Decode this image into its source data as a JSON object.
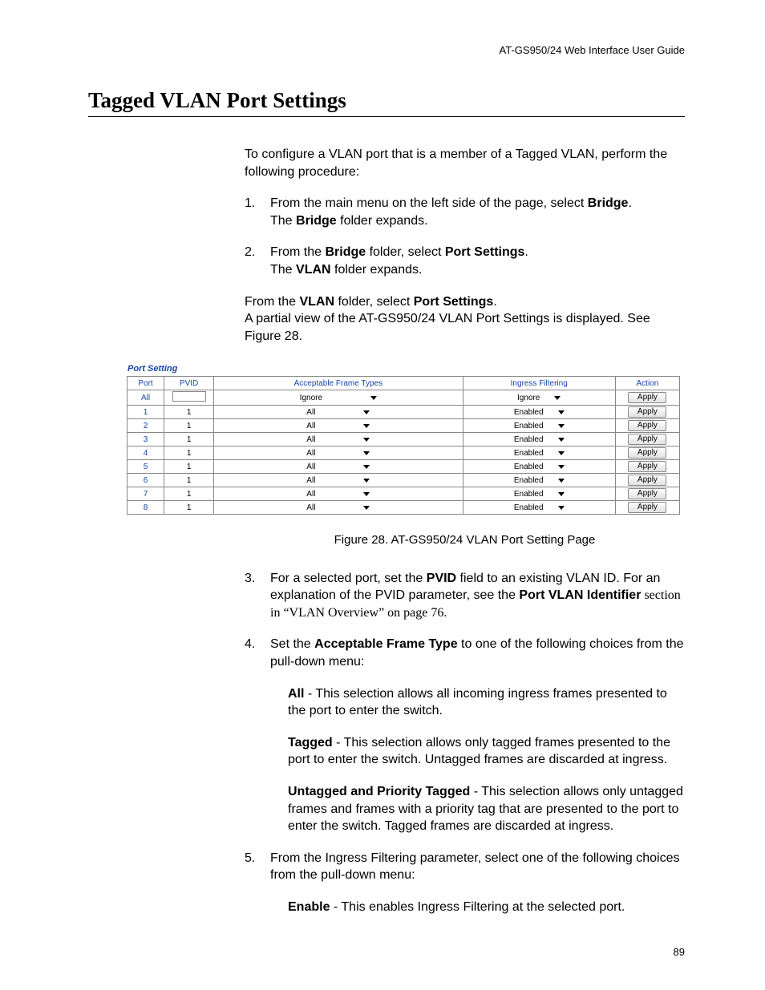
{
  "header": {
    "guide": "AT-GS950/24  Web Interface User Guide"
  },
  "title": "Tagged VLAN Port Settings",
  "intro": "To configure a VLAN port that is a member of a Tagged VLAN, perform the following procedure:",
  "step1": {
    "num": "1.",
    "a": "From the main menu on the left side of the page, select ",
    "b": "Bridge",
    "c": ".",
    "d": "The ",
    "e": "Bridge",
    "f": " folder expands."
  },
  "step2": {
    "num": "2.",
    "a": "From the ",
    "b": "Bridge",
    "c": " folder, select ",
    "d": "Port Settings",
    "e": ".",
    "f": "The ",
    "g": "VLAN",
    "h": " folder expands."
  },
  "vlan": {
    "a": "From the ",
    "b": "VLAN",
    "c": " folder, select ",
    "d": "Port Settings",
    "e": ".",
    "f": "A partial view of the AT-GS950/24 VLAN Port Settings is displayed. See Figure 28."
  },
  "ui": {
    "heading": "Port Setting",
    "cols": {
      "port": "Port",
      "pvid": "PVID",
      "aft": "Acceptable Frame Types",
      "if": "Ingress Filtering",
      "act": "Action"
    },
    "allrow": {
      "port": "All",
      "aft": "Ignore",
      "if": "Ignore",
      "btn": "Apply"
    },
    "rows": [
      {
        "port": "1",
        "pvid": "1",
        "aft": "All",
        "if": "Enabled",
        "btn": "Apply"
      },
      {
        "port": "2",
        "pvid": "1",
        "aft": "All",
        "if": "Enabled",
        "btn": "Apply"
      },
      {
        "port": "3",
        "pvid": "1",
        "aft": "All",
        "if": "Enabled",
        "btn": "Apply"
      },
      {
        "port": "4",
        "pvid": "1",
        "aft": "All",
        "if": "Enabled",
        "btn": "Apply"
      },
      {
        "port": "5",
        "pvid": "1",
        "aft": "All",
        "if": "Enabled",
        "btn": "Apply"
      },
      {
        "port": "6",
        "pvid": "1",
        "aft": "All",
        "if": "Enabled",
        "btn": "Apply"
      },
      {
        "port": "7",
        "pvid": "1",
        "aft": "All",
        "if": "Enabled",
        "btn": "Apply"
      },
      {
        "port": "8",
        "pvid": "1",
        "aft": "All",
        "if": "Enabled",
        "btn": "Apply"
      }
    ]
  },
  "figcap": "Figure 28. AT-GS950/24 VLAN Port Setting Page",
  "step3": {
    "num": "3.",
    "a": "For a selected port, set the ",
    "b": "PVID",
    "c": " field to an existing VLAN ID. For an explanation of the PVID parameter, see the ",
    "d": "Port VLAN Identifier",
    "e": " section in “VLAN Overview” on page 76."
  },
  "step4": {
    "num": "4.",
    "a": "Set the ",
    "b": "Acceptable Frame Type",
    "c": " to one of the following choices from the pull-down menu:"
  },
  "opt_all": {
    "label": "All",
    "text": " - This selection allows all incoming ingress frames presented to the port to enter the switch."
  },
  "opt_tag": {
    "label": "Tagged",
    "text": " - This selection allows only tagged frames presented to the port to enter the switch. Untagged frames are discarded at ingress."
  },
  "opt_unt": {
    "label": "Untagged and Priority Tagged",
    "text": " - This selection allows only untagged frames and frames with a priority tag that are presented to the port to enter the switch. Tagged frames are discarded at ingress."
  },
  "step5": {
    "num": "5.",
    "text": "From the Ingress Filtering parameter, select one of the following choices from the pull-down menu:"
  },
  "opt_en": {
    "label": "Enable",
    "text": " - This enables Ingress Filtering at the selected port."
  },
  "pagenum": "89"
}
